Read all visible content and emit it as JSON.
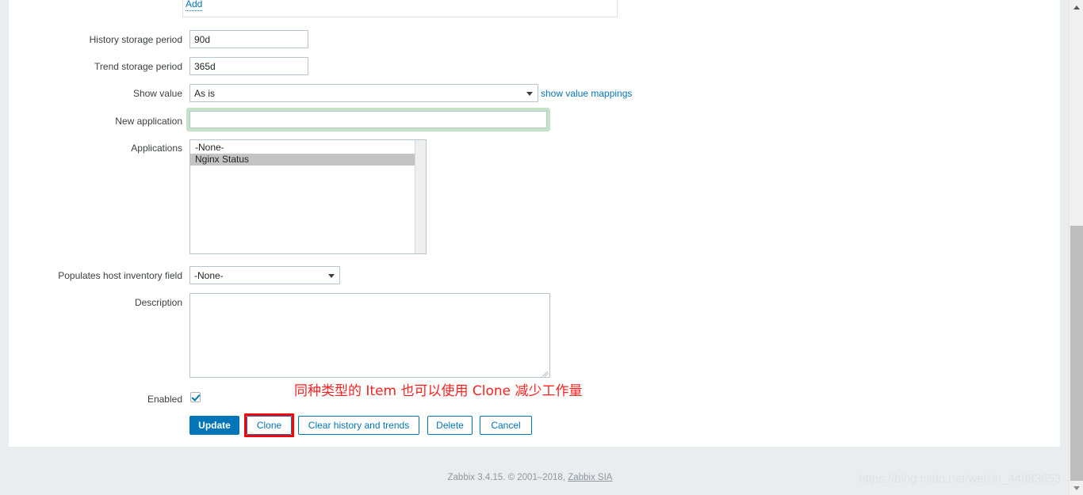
{
  "app": {
    "product": "Zabbix",
    "version": "3.4.15"
  },
  "form": {
    "add_link": "Add",
    "rows": [
      {
        "label": "History storage period",
        "value": "90d"
      },
      {
        "label": "Trend storage period",
        "value": "365d"
      },
      {
        "label": "Show value",
        "value": "As is"
      },
      {
        "label": "New application",
        "value": ""
      },
      {
        "label": "Applications",
        "value": "Nginx Status"
      },
      {
        "label": "Populates host inventory field",
        "value": "-None-"
      },
      {
        "label": "Description",
        "value": ""
      },
      {
        "label": "Enabled",
        "value": "checked"
      }
    ],
    "history_label": "History storage period",
    "history_value": "90d",
    "trend_label": "Trend storage period",
    "trend_value": "365d",
    "show_value_label": "Show value",
    "show_value_selected": "As is",
    "show_value_mappings_link": "show value mappings",
    "new_application_label": "New application",
    "new_application_value": "",
    "applications_label": "Applications",
    "applications_options": [
      {
        "label": "-None-",
        "selected": false
      },
      {
        "label": "Nginx Status",
        "selected": true
      }
    ],
    "inventory_label": "Populates host inventory field",
    "inventory_selected": "-None-",
    "description_label": "Description",
    "description_value": "",
    "enabled_label": "Enabled",
    "enabled_checked": true
  },
  "buttons": {
    "update": "Update",
    "clone": "Clone",
    "clear_history": "Clear history and trends",
    "delete": "Delete",
    "cancel": "Cancel"
  },
  "annotation": {
    "text": "同种类型的 Item 也可以使用 Clone 减少工作量",
    "color": "#fd2020"
  },
  "footer": {
    "text": "Zabbix 3.4.15. © 2001–2018, ",
    "link": "Zabbix SIA"
  },
  "watermark": {
    "text": "https://blog.csdn.net/weixin_44983653"
  },
  "colors": {
    "accent": "#0275b8",
    "page_background": "#e9edf0",
    "panel": "#ffffff",
    "highlight_red": "#fe0000",
    "focus_green": "#c6e2c8",
    "selected_row": "#c4c4c4"
  }
}
